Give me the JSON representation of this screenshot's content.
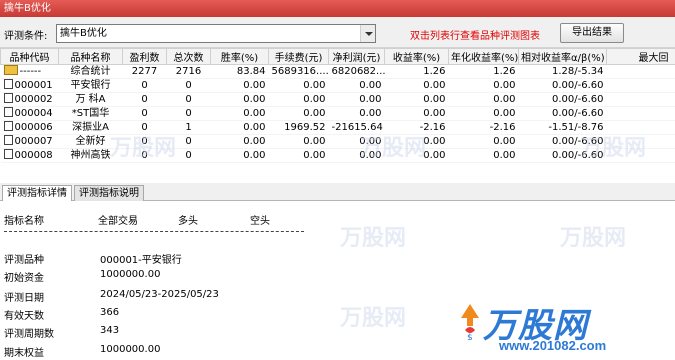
{
  "window": {
    "title": "擒牛B优化"
  },
  "toolbar": {
    "condition_label": "评测条件:",
    "condition_value": "擒牛B优化",
    "hint": "双击列表行查看品种评测图表",
    "export_label": "导出结果"
  },
  "table": {
    "columns": [
      "品种代码",
      "品种名称",
      "盈利数",
      "总次数",
      "胜率(%)",
      "手续费(元)",
      "净利润(元)",
      "收益率(%)",
      "年化收益率(%)",
      "相对收益率α/β(%)",
      "最大回"
    ],
    "rows": [
      {
        "code": "------",
        "name": "综合统计",
        "profit": "2277",
        "total": "2716",
        "win": "83.84",
        "fee": "5689316....",
        "net": "6820682...",
        "ret": "1.26",
        "annual": "1.26",
        "rel": "1.28/-5.34",
        "maxdd": "64"
      },
      {
        "code": "000001",
        "name": "平安银行",
        "profit": "0",
        "total": "0",
        "win": "0.00",
        "fee": "0.00",
        "net": "0.00",
        "ret": "0.00",
        "annual": "0.00",
        "rel": "0.00/-6.60",
        "maxdd": ""
      },
      {
        "code": "000002",
        "name": "万 科A",
        "profit": "0",
        "total": "0",
        "win": "0.00",
        "fee": "0.00",
        "net": "0.00",
        "ret": "0.00",
        "annual": "0.00",
        "rel": "0.00/-6.60",
        "maxdd": ""
      },
      {
        "code": "000004",
        "name": "*ST国华",
        "profit": "0",
        "total": "0",
        "win": "0.00",
        "fee": "0.00",
        "net": "0.00",
        "ret": "0.00",
        "annual": "0.00",
        "rel": "0.00/-6.60",
        "maxdd": ""
      },
      {
        "code": "000006",
        "name": "深振业A",
        "profit": "0",
        "total": "1",
        "win": "0.00",
        "fee": "1969.52",
        "net": "-21615.64",
        "ret": "-2.16",
        "annual": "-2.16",
        "rel": "-1.51/-8.76",
        "maxdd": "21"
      },
      {
        "code": "000007",
        "name": "全新好",
        "profit": "0",
        "total": "0",
        "win": "0.00",
        "fee": "0.00",
        "net": "0.00",
        "ret": "0.00",
        "annual": "0.00",
        "rel": "0.00/-6.60",
        "maxdd": ""
      },
      {
        "code": "000008",
        "name": "神州高铁",
        "profit": "0",
        "total": "0",
        "win": "0.00",
        "fee": "0.00",
        "net": "0.00",
        "ret": "0.00",
        "annual": "0.00",
        "rel": "0.00/-6.60",
        "maxdd": ""
      }
    ]
  },
  "tabs": [
    {
      "label": "评测指标详情"
    },
    {
      "label": "评测指标说明"
    }
  ],
  "detail": {
    "headers": [
      "指标名称",
      "全部交易",
      "多头",
      "空头"
    ],
    "items": [
      {
        "label": "评测品种",
        "value": "000001-平安银行"
      },
      {
        "label": "初始资金",
        "value": "1000000.00"
      },
      {
        "label": "评测日期",
        "value": "2024/05/23-2025/05/23"
      },
      {
        "label": "有效天数",
        "value": "366"
      },
      {
        "label": "评测周期数",
        "value": " 343"
      },
      {
        "label": "期末权益",
        "value": "1000000.00"
      }
    ]
  },
  "watermark": {
    "brand": "万股网",
    "url": "www.201082.com",
    "faint": "万股网"
  },
  "colors": {
    "title_bar": "#d4463f",
    "hint": "#e00000",
    "brand": "#2d79d6"
  }
}
